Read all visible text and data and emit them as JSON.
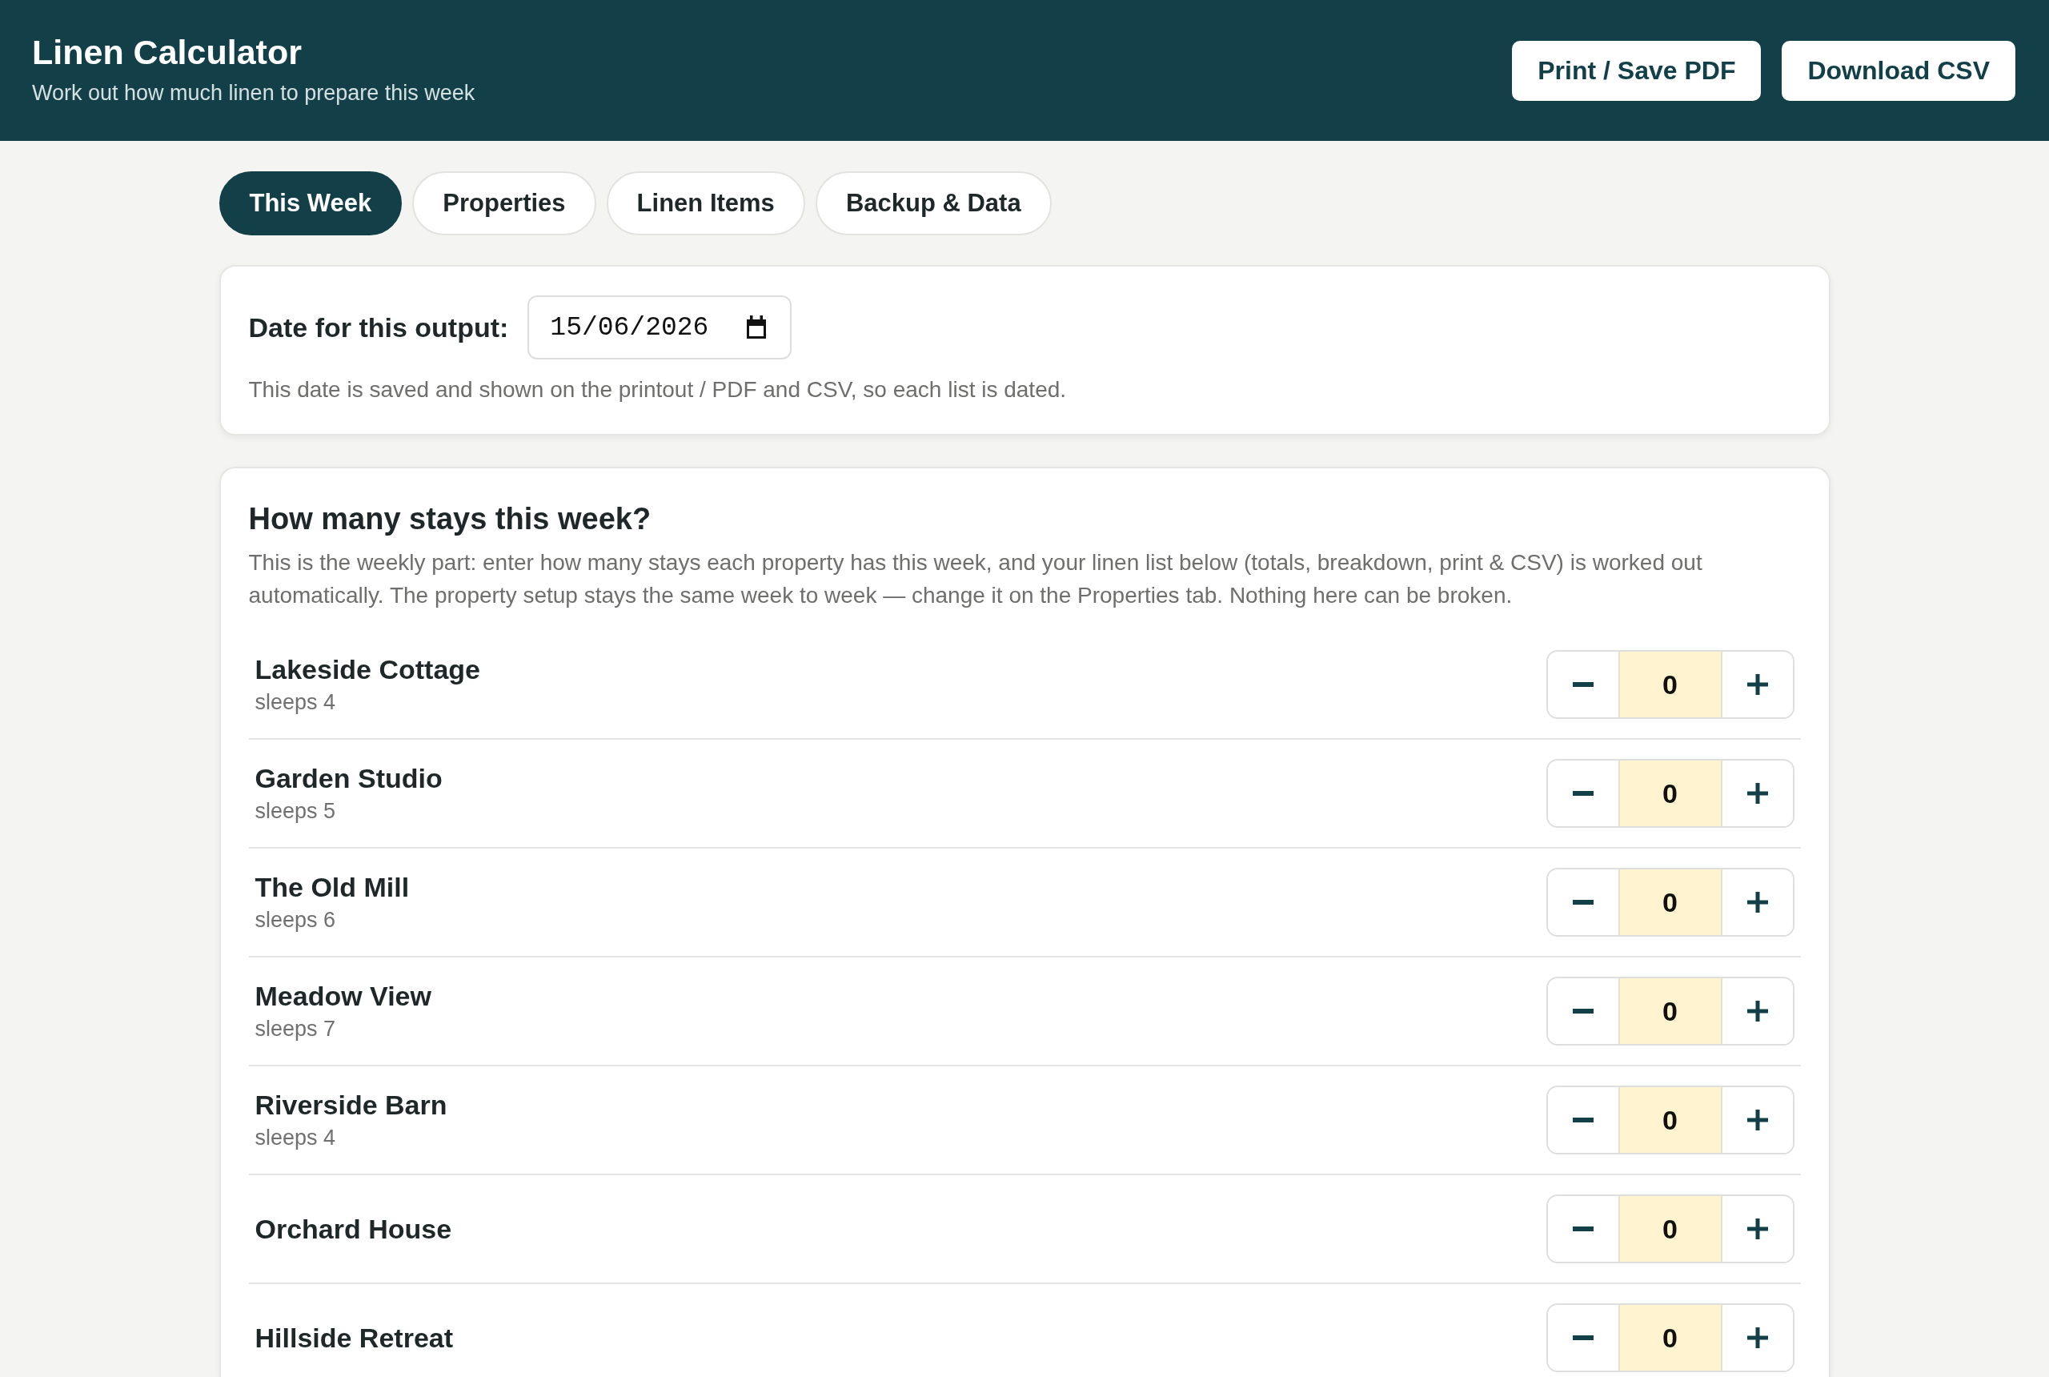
{
  "header": {
    "title": "Linen Calculator",
    "subtitle": "Work out how much linen to prepare this week",
    "buttons": [
      "Print / Save PDF",
      "Download CSV"
    ]
  },
  "tabs": [
    {
      "label": "This Week",
      "selected": true
    },
    {
      "label": "Properties",
      "selected": false
    },
    {
      "label": "Linen Items",
      "selected": false
    },
    {
      "label": "Backup & Data",
      "selected": false
    }
  ],
  "date_card": {
    "label": "Date for this output:",
    "date_field": {
      "value": "15/06/2026"
    },
    "note": "This date is saved and shown on the printout / PDF and CSV, so each list is dated."
  },
  "stays_card": {
    "title": "How many stays this week?",
    "description": "This is the weekly part: enter how many stays each property has this week, and your linen list below (totals, breakdown, print & CSV) is worked out automatically. The property setup stays the same week to week — change it on the Properties tab. Nothing here can be broken.",
    "properties": [
      {
        "name": "Lakeside Cottage",
        "sleeps": "sleeps 4",
        "stays": "0"
      },
      {
        "name": "Garden Studio",
        "sleeps": "sleeps 5",
        "stays": "0"
      },
      {
        "name": "The Old Mill",
        "sleeps": "sleeps 6",
        "stays": "0"
      },
      {
        "name": "Meadow View",
        "sleeps": "sleeps 7",
        "stays": "0"
      },
      {
        "name": "Riverside Barn",
        "sleeps": "sleeps 4",
        "stays": "0"
      },
      {
        "name": "Orchard House",
        "stays": "0"
      },
      {
        "name": "Hillside Retreat",
        "stays": "0"
      }
    ]
  }
}
